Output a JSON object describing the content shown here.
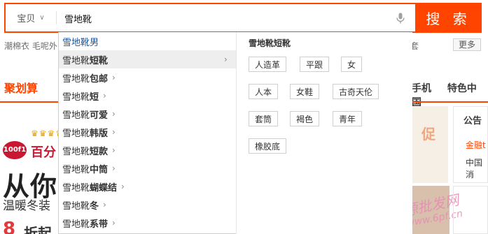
{
  "search": {
    "scope_label": "宝贝",
    "query": "雪地靴",
    "button_label": "搜 索"
  },
  "hint_row": {
    "hot_words": "潮棉衣  毛呢外",
    "tail_word": "套",
    "more_label": "更多"
  },
  "nav": {
    "left_item": "聚划算",
    "right_items": [
      "手机",
      "特色中国"
    ]
  },
  "promo": {
    "crowns": "♛♛♛♛",
    "brand_logo": "100f1",
    "brand_name": "百分",
    "headline": "从你的",
    "subline": "温暖冬装",
    "digit": "8",
    "word": "折起",
    "image_text": "促",
    "watermark": "货源批发网",
    "watermark_site": "www.6pf.cn"
  },
  "notice": {
    "title": "公告",
    "line1": "金融t",
    "line2": "中国消"
  },
  "suggestions": [
    {
      "prefix": "雪地靴",
      "suffix": " 男",
      "style": "plain",
      "arrow": false
    },
    {
      "prefix": "雪地靴",
      "suffix": "短靴",
      "style": "bold",
      "arrow": true,
      "active": true
    },
    {
      "prefix": "雪地靴",
      "suffix": "包邮",
      "style": "bold",
      "arrow": true
    },
    {
      "prefix": "雪地靴",
      "suffix": "短",
      "style": "bold",
      "arrow": true
    },
    {
      "prefix": "雪地靴",
      "suffix": "可爱",
      "style": "bold",
      "arrow": true
    },
    {
      "prefix": "雪地靴",
      "suffix": "韩版",
      "style": "bold",
      "arrow": true
    },
    {
      "prefix": "雪地靴",
      "suffix": "短款",
      "style": "bold",
      "arrow": true
    },
    {
      "prefix": "雪地靴",
      "suffix": "中筒",
      "style": "bold",
      "arrow": true
    },
    {
      "prefix": "雪地靴",
      "suffix": "蝴蝶结",
      "style": "bold",
      "arrow": true
    },
    {
      "prefix": "雪地靴",
      "suffix": "冬",
      "style": "bold",
      "arrow": true
    },
    {
      "prefix": "雪地靴",
      "suffix": "系带",
      "style": "bold",
      "arrow": true
    }
  ],
  "panel": {
    "title": "雪地靴短靴",
    "tags": [
      "人造革",
      "平跟",
      "女",
      "人本",
      "女鞋",
      "古奇天伦",
      "套筒",
      "褐色",
      "青年",
      "橡胶底"
    ]
  },
  "colors": {
    "accent": "#ff4400",
    "link": "#1e56a0",
    "hover_bg": "#eeeeee"
  },
  "icons": {
    "scope_caret": "chevron-down-icon",
    "voice": "microphone-icon",
    "submenu": "chevron-right-icon"
  }
}
